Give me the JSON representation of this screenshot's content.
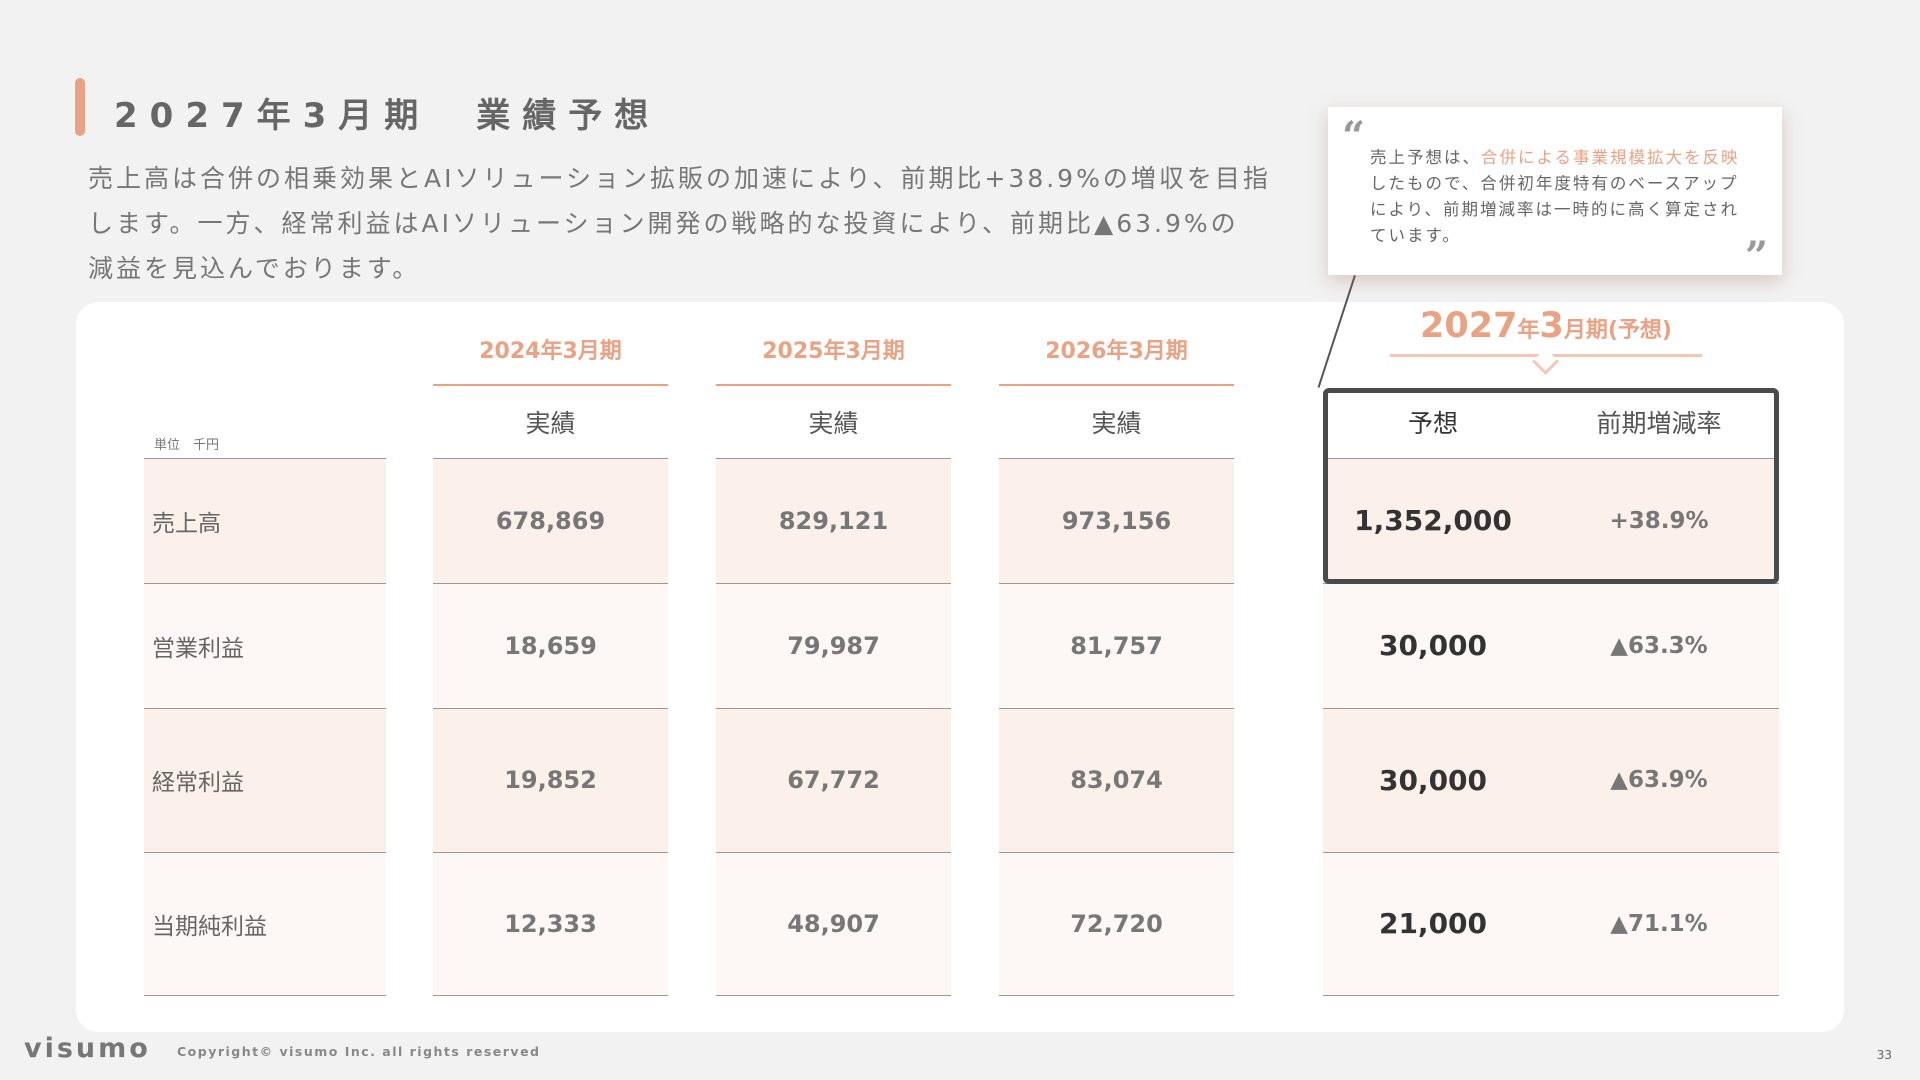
{
  "title": "2027年3月期　業績予想",
  "lead": {
    "line1": "売上高は合併の相乗効果とAIソリューション拡販の加速により、前期比+38.9%の増収を目指",
    "line2": "します。一方、経常利益はAIソリューション開発の戦略的な投資により、前期比▲63.9%の",
    "line3": "減益を見込んでおります。"
  },
  "quote": {
    "open_mark": "“",
    "close_mark": "”",
    "prefix": "売上予想は、",
    "highlight": "合併による事業規模拡大を反映",
    "rest": "したもので、合併初年度特有のベースアップにより、前期増減率は一時的に高く算定されています。"
  },
  "table": {
    "unit": "単位　千円",
    "years": [
      "2024年3月期",
      "2025年3月期",
      "2026年3月期"
    ],
    "actual_label": "実績",
    "forecast": {
      "year_big": "2027",
      "year_unit": "年",
      "month_big": "3",
      "month_rest": "月期(予想)",
      "forecast_col": "予想",
      "change_col": "前期増減率"
    },
    "rows": [
      {
        "label": "売上高",
        "values": [
          "678,869",
          "829,121",
          "973,156"
        ],
        "forecast": "1,352,000",
        "change": "+38.9%"
      },
      {
        "label": "営業利益",
        "values": [
          "18,659",
          "79,987",
          "81,757"
        ],
        "forecast": "30,000",
        "change": "▲63.3%"
      },
      {
        "label": "経常利益",
        "values": [
          "19,852",
          "67,772",
          "83,074"
        ],
        "forecast": "30,000",
        "change": "▲63.9%"
      },
      {
        "label": "当期純利益",
        "values": [
          "12,333",
          "48,907",
          "72,720"
        ],
        "forecast": "21,000",
        "change": "▲71.1%"
      }
    ]
  },
  "footer": {
    "logo": "visumo",
    "copyright": "Copyright© visumo Inc. all rights reserved",
    "page": "33"
  },
  "colors": {
    "accent": "#e9a284",
    "row_odd": "#fcf0eb",
    "row_even": "#fdf7f5"
  }
}
